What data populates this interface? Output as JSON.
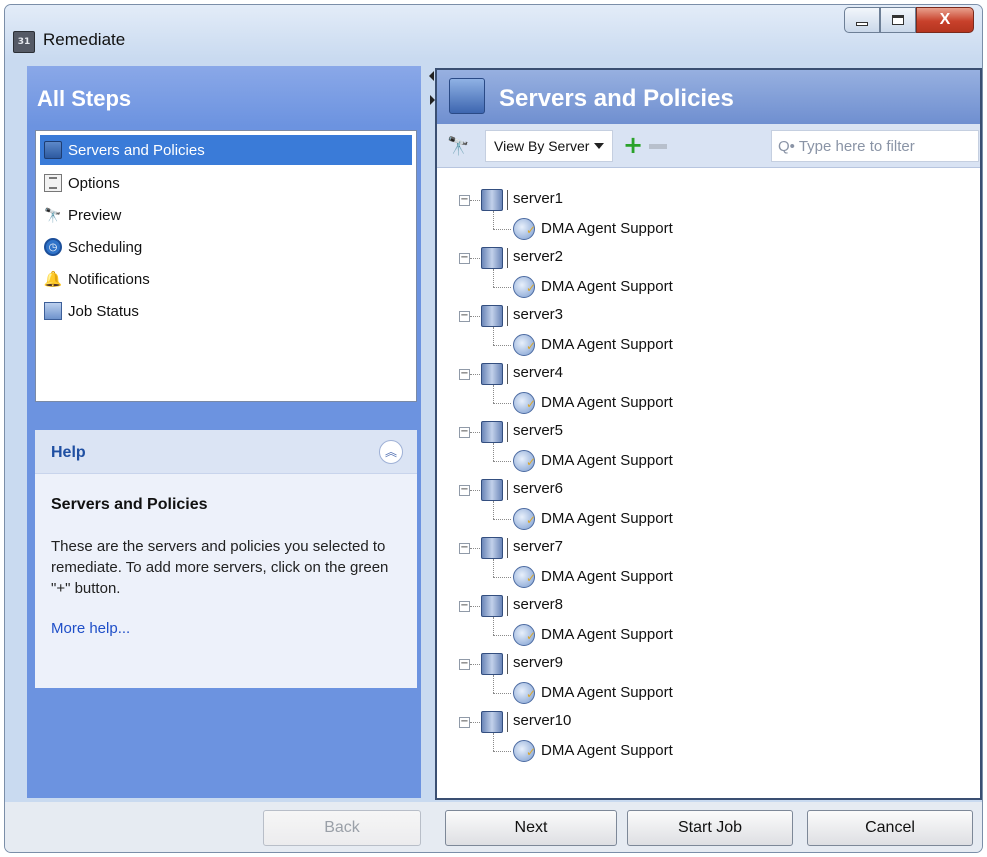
{
  "window": {
    "title": "Remediate",
    "app_icon_text": "31",
    "controls": {
      "minimize": "—",
      "maximize": "▢",
      "close": "X"
    }
  },
  "steps_panel": {
    "header": "All Steps",
    "items": [
      {
        "label": "Servers and Policies",
        "icon": "servers-icon",
        "selected": true
      },
      {
        "label": "Options",
        "icon": "options-icon",
        "selected": false
      },
      {
        "label": "Preview",
        "icon": "binoculars-icon",
        "selected": false
      },
      {
        "label": "Scheduling",
        "icon": "clock-icon",
        "selected": false
      },
      {
        "label": "Notifications",
        "icon": "bell-icon",
        "selected": false
      },
      {
        "label": "Job Status",
        "icon": "job-status-icon",
        "selected": false
      }
    ]
  },
  "help": {
    "title": "Help",
    "heading": "Servers and Policies",
    "text": "These are the servers and policies you selected to remediate. To add more servers, click on the green \"+\" button.",
    "link": "More help..."
  },
  "main": {
    "title": "Servers and Policies",
    "toolbar": {
      "view_select": "View By Server",
      "filter_placeholder": "Q• Type here to filter"
    },
    "tree": [
      {
        "server": "server1",
        "policy": "DMA Agent Support"
      },
      {
        "server": "server2",
        "policy": "DMA Agent Support"
      },
      {
        "server": "server3",
        "policy": "DMA Agent Support"
      },
      {
        "server": "server4",
        "policy": "DMA Agent Support"
      },
      {
        "server": "server5",
        "policy": "DMA Agent Support"
      },
      {
        "server": "server6",
        "policy": "DMA Agent Support"
      },
      {
        "server": "server7",
        "policy": "DMA Agent Support"
      },
      {
        "server": "server8",
        "policy": "DMA Agent Support"
      },
      {
        "server": "server9",
        "policy": "DMA Agent Support"
      },
      {
        "server": "server10",
        "policy": "DMA Agent Support"
      }
    ]
  },
  "buttons": {
    "back": "Back",
    "next": "Next",
    "start_job": "Start Job",
    "cancel": "Cancel"
  },
  "colors": {
    "selection": "#3a7bd8",
    "header_blue": "#6c93e0",
    "add_green": "#2aa22a",
    "close_red": "#c8412b"
  }
}
